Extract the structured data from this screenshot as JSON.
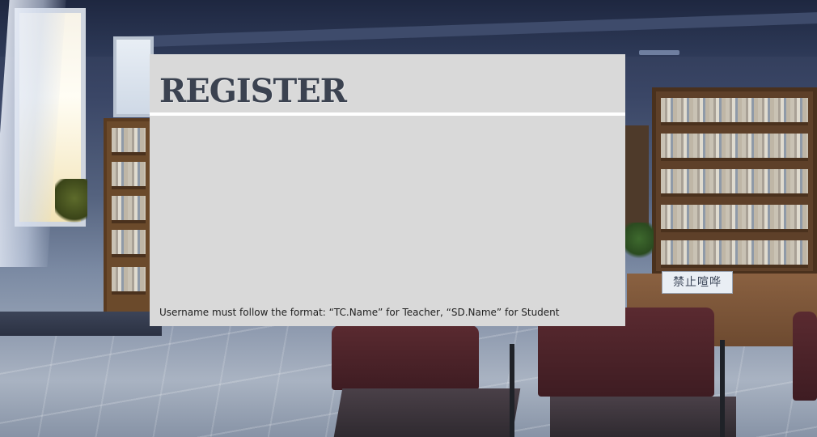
{
  "register_panel": {
    "title": "REGISTER",
    "format_note": "Username must follow the format: “TC.Name” for Teacher, “SD.Name” for Student"
  },
  "background": {
    "sign_text": "禁止喧哗"
  },
  "colors": {
    "panel_bg": "#d9d9d9",
    "title_color": "#3b4250",
    "divider": "#ffffff"
  }
}
